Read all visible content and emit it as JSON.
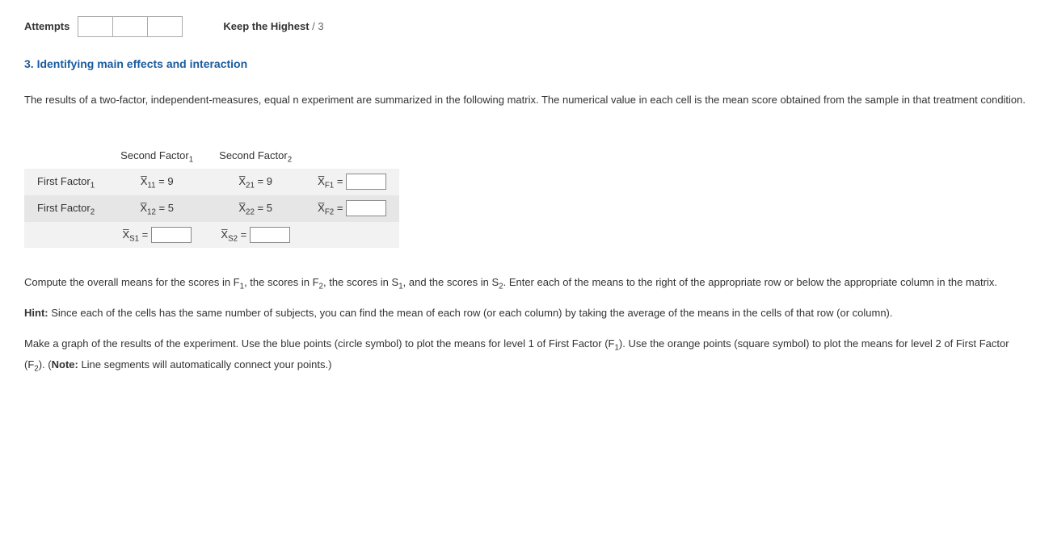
{
  "top": {
    "attempts_label": "Attempts",
    "keep_label": "Keep the Highest",
    "keep_suffix": " / 3"
  },
  "question": {
    "title": "3. Identifying main effects and interaction"
  },
  "intro": "The results of a two-factor, independent-measures, equal n experiment are summarized in the following matrix. The numerical value in each cell is the mean score obtained from the sample in that treatment condition.",
  "matrix": {
    "col_headers": {
      "s1": "Second Factor",
      "s1_sub": "1",
      "s2": "Second Factor",
      "s2_sub": "2"
    },
    "row_headers": {
      "f1": "First Factor",
      "f1_sub": "1",
      "f2": "First Factor",
      "f2_sub": "2"
    },
    "cells": {
      "x11": {
        "sub": "11",
        "value": "9"
      },
      "x21": {
        "sub": "21",
        "value": "9"
      },
      "x12": {
        "sub": "12",
        "value": "5"
      },
      "x22": {
        "sub": "22",
        "value": "5"
      }
    },
    "marginals": {
      "xf1": {
        "sub": "F1"
      },
      "xf2": {
        "sub": "F2"
      },
      "xs1": {
        "sub": "S1"
      },
      "xs2": {
        "sub": "S2"
      }
    }
  },
  "para_compute_a": "Compute the overall means for the scores in F",
  "para_compute_b": ", the scores in F",
  "para_compute_c": ", the scores in S",
  "para_compute_d": ", and the scores in S",
  "para_compute_e": ". Enter each of the means to the right of the appropriate row or below the appropriate column in the matrix.",
  "hint_label": "Hint:",
  "hint_body": " Since each of the cells has the same number of subjects, you can find the mean of each row (or each column) by taking the average of the means in the cells of that row (or column).",
  "graph_a": "Make a graph of the results of the experiment. Use the blue points (circle symbol) to plot the means for level 1 of First Factor (F",
  "graph_b": "). Use the orange points (square symbol) to plot the means for level 2 of First Factor (F",
  "graph_c": "). (",
  "note_label": "Note:",
  "graph_d": " Line segments will automatically connect your points.)",
  "subs": {
    "one": "1",
    "two": "2"
  }
}
